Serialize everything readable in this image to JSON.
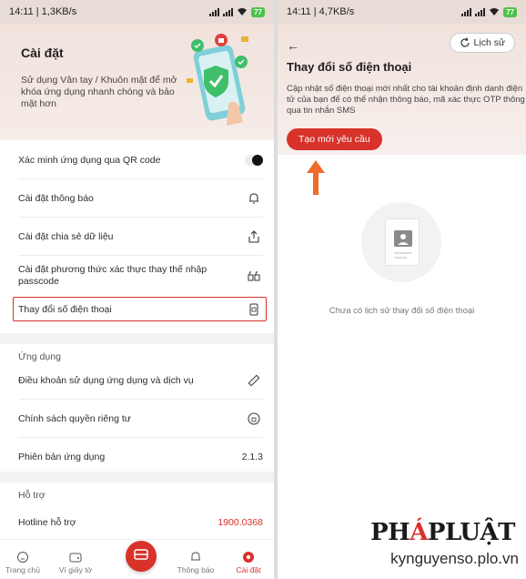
{
  "left_screen": {
    "status_bar": {
      "time": "14:11 | 1,3KB/s",
      "battery": "77"
    },
    "header": {
      "title": "Cài đặt",
      "description": "Sử dụng Vân tay / Khuôn mặt để mở khóa ứng dụng nhanh chóng và bảo mật hơn"
    },
    "settings": [
      {
        "label": "Xác minh ứng dụng qua QR code",
        "icon": "toggle-off"
      },
      {
        "label": "Cài đặt thông báo",
        "icon": "bell-icon"
      },
      {
        "label": "Cài đặt chia sẻ dữ liệu",
        "icon": "share-icon"
      },
      {
        "label": "Cài đặt phương thức xác thực thay thế nhập passcode",
        "icon": "lock-swap-icon"
      },
      {
        "label": "Thay đổi số điện thoại",
        "icon": "phone-icon",
        "highlighted": true
      }
    ],
    "app_section": {
      "title": "Ứng dụng",
      "items": [
        {
          "label": "Điều khoản sử dụng ứng dụng và dịch vụ",
          "icon": "ruler-icon"
        },
        {
          "label": "Chính sách quyền riêng tư",
          "icon": "privacy-icon"
        },
        {
          "label": "Phiên bản ứng dụng",
          "value": "2.1.3"
        }
      ]
    },
    "support_section": {
      "title": "Hỗ trợ",
      "hotline_label": "Hotline hỗ trợ",
      "hotline_value": "1900.0368"
    },
    "bottom_nav": [
      {
        "label": "Trang chủ",
        "icon": "home-icon"
      },
      {
        "label": "Ví giấy tờ",
        "icon": "wallet-icon"
      },
      {
        "label": "",
        "icon": "scan-icon"
      },
      {
        "label": "Thông báo",
        "icon": "bell-icon"
      },
      {
        "label": "Cài đặt",
        "icon": "settings-icon",
        "active": true
      }
    ]
  },
  "right_screen": {
    "status_bar": {
      "time": "14:11 | 4,7KB/s",
      "battery": "77"
    },
    "history_button": "Lịch sử",
    "title": "Thay đổi số điện thoại",
    "description": "Cập nhật số điện thoại mới nhất cho tài khoản định danh điện tử của bạn để có thể nhận thông báo, mã xác thực OTP thông qua tin nhắn SMS",
    "cta": "Tạo mới yêu cầu",
    "empty_state": "Chưa có lịch sử thay đổi số điện thoại"
  },
  "watermark": {
    "logo": "PHÁPLUẬT",
    "site": "kynguyenso.plo.vn"
  },
  "colors": {
    "accent": "#d8322b",
    "header_bg": "#f1e2dc",
    "arrow": "#f06a2a"
  }
}
